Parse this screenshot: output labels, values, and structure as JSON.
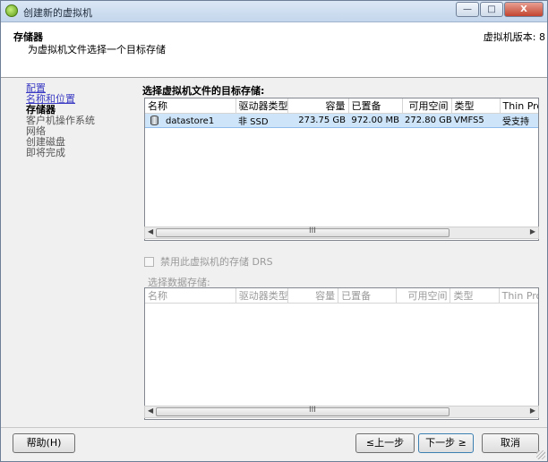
{
  "window": {
    "title": "创建新的虚拟机",
    "minimize": "—",
    "maximize": "□",
    "close": "X"
  },
  "header": {
    "title": "存储器",
    "subtitle": "为虚拟机文件选择一个目标存储",
    "version": "虚拟机版本: 8"
  },
  "nav": {
    "items": [
      {
        "label": "配置",
        "state": "link"
      },
      {
        "label": "名称和位置",
        "state": "link"
      },
      {
        "label": "存储器",
        "state": "active"
      },
      {
        "label": "客户机操作系统",
        "state": "pending"
      },
      {
        "label": "网络",
        "state": "pending"
      },
      {
        "label": "创建磁盘",
        "state": "pending"
      },
      {
        "label": "即将完成",
        "state": "pending"
      }
    ]
  },
  "main": {
    "label": "选择虚拟机文件的目标存储:",
    "columns": [
      "名称",
      "驱动器类型",
      "容量",
      "已置备",
      "可用空间",
      "类型",
      "Thin Prov"
    ],
    "rows": [
      {
        "name": "datastore1",
        "drive_type": "非 SSD",
        "capacity": "273.75 GB",
        "provisioned": "972.00 MB",
        "free": "272.80 GB",
        "type": "VMFS5",
        "thin": "受支持"
      }
    ],
    "scroll_grip": "III"
  },
  "drs": {
    "label": "禁用此虚拟机的存储 DRS",
    "checked": false
  },
  "datastore_select": {
    "label": "选择数据存储:",
    "columns": [
      "名称",
      "驱动器类型",
      "容量",
      "已置备",
      "可用空间",
      "类型",
      "Thin Provi"
    ]
  },
  "footer": {
    "help": "帮助(H)",
    "back": "≤上一步",
    "next": "下一步 ≥",
    "cancel": "取消"
  }
}
